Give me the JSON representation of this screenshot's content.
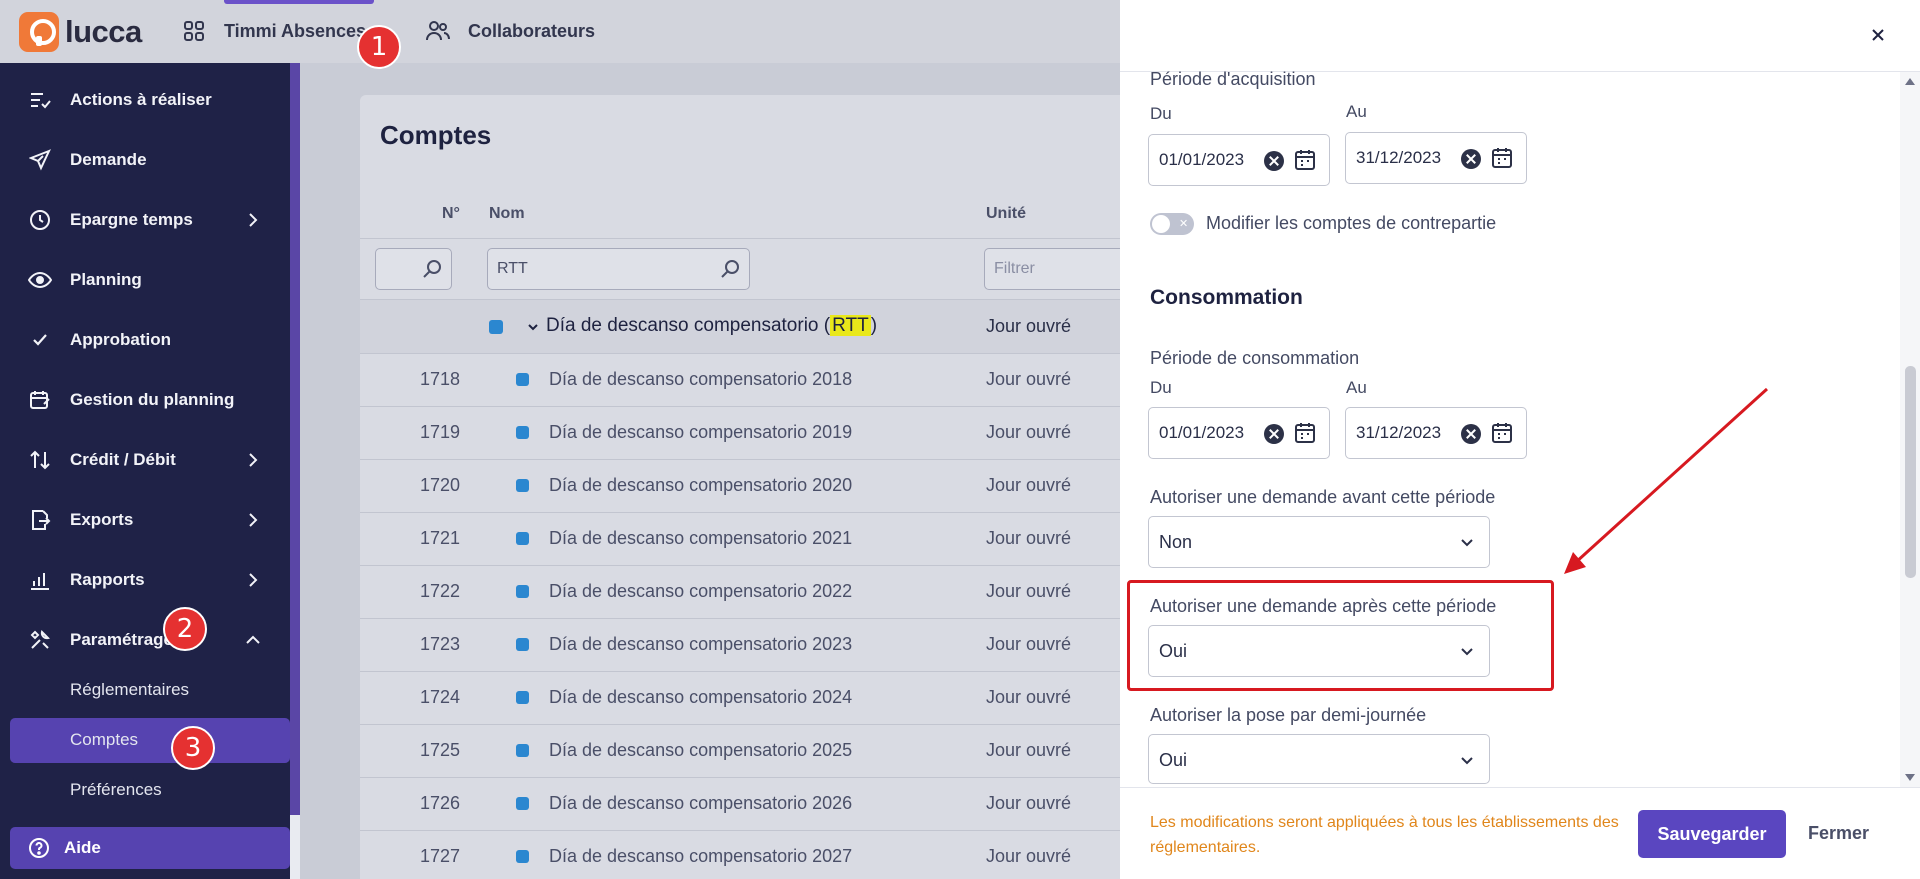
{
  "app": {
    "logo_text": "lucca"
  },
  "topnav": {
    "apps_label": "Timmi Absences",
    "users_label": "Collaborateurs"
  },
  "sidebar": {
    "items": [
      {
        "label": "Actions à réaliser",
        "icon": "list-check-icon"
      },
      {
        "label": "Demande",
        "icon": "paper-plane-icon"
      },
      {
        "label": "Epargne temps",
        "icon": "clock-icon"
      },
      {
        "label": "Planning",
        "icon": "eye-icon"
      },
      {
        "label": "Approbation",
        "icon": "check-icon"
      },
      {
        "label": "Gestion du planning",
        "icon": "calendar-edit-icon"
      },
      {
        "label": "Crédit / Débit",
        "icon": "arrows-up-down-icon"
      },
      {
        "label": "Exports",
        "icon": "file-export-icon"
      },
      {
        "label": "Rapports",
        "icon": "bar-chart-icon"
      },
      {
        "label": "Paramétrage",
        "icon": "tools-icon"
      }
    ],
    "sub_items": [
      "Réglementaires",
      "Comptes",
      "Préférences"
    ],
    "help_label": "Aide"
  },
  "main": {
    "title": "Comptes",
    "columns": {
      "num": "N°",
      "name": "Nom",
      "unit": "Unité"
    },
    "filters": {
      "name_value": "RTT",
      "unit_placeholder": "Filtrer"
    },
    "group": {
      "prefix": "Día de descanso compensatorio (",
      "highlight": "RTT",
      "suffix": ")",
      "unit": "Jour ouvré"
    },
    "rows": [
      {
        "num": "1718",
        "name": "Día de descanso compensatorio 2018",
        "unit": "Jour ouvré"
      },
      {
        "num": "1719",
        "name": "Día de descanso compensatorio 2019",
        "unit": "Jour ouvré"
      },
      {
        "num": "1720",
        "name": "Día de descanso compensatorio 2020",
        "unit": "Jour ouvré"
      },
      {
        "num": "1721",
        "name": "Día de descanso compensatorio 2021",
        "unit": "Jour ouvré"
      },
      {
        "num": "1722",
        "name": "Día de descanso compensatorio 2022",
        "unit": "Jour ouvré"
      },
      {
        "num": "1723",
        "name": "Día de descanso compensatorio 2023",
        "unit": "Jour ouvré"
      },
      {
        "num": "1724",
        "name": "Día de descanso compensatorio 2024",
        "unit": "Jour ouvré"
      },
      {
        "num": "1725",
        "name": "Día de descanso compensatorio 2025",
        "unit": "Jour ouvré"
      },
      {
        "num": "1726",
        "name": "Día de descanso compensatorio 2026",
        "unit": "Jour ouvré"
      },
      {
        "num": "1727",
        "name": "Día de descanso compensatorio 2027",
        "unit": "Jour ouvré"
      }
    ]
  },
  "panel": {
    "acq_label": "Période d'acquisition",
    "from_label": "Du",
    "to_label": "Au",
    "acq_from": "01/01/2023",
    "acq_to": "31/12/2023",
    "toggle_label": "Modifier les comptes de contrepartie",
    "conso_title": "Consommation",
    "conso_label": "Période de consommation",
    "conso_from": "01/01/2023",
    "conso_to": "31/12/2023",
    "before_label": "Autoriser une demande avant cette période",
    "before_value": "Non",
    "after_label": "Autoriser une demande après cette période",
    "after_value": "Oui",
    "half_label": "Autoriser la pose par demi-journée",
    "half_value": "Oui",
    "warning": "Les modifications seront appliquées à tous les établissements des réglementaires.",
    "save_label": "Sauvegarder",
    "close_label": "Fermer"
  },
  "markers": [
    "1",
    "2",
    "3"
  ],
  "colors": {
    "accent": "#5a46c0",
    "sidebar": "#1f2247",
    "warning": "#e0861b",
    "annotation": "#d71920"
  }
}
